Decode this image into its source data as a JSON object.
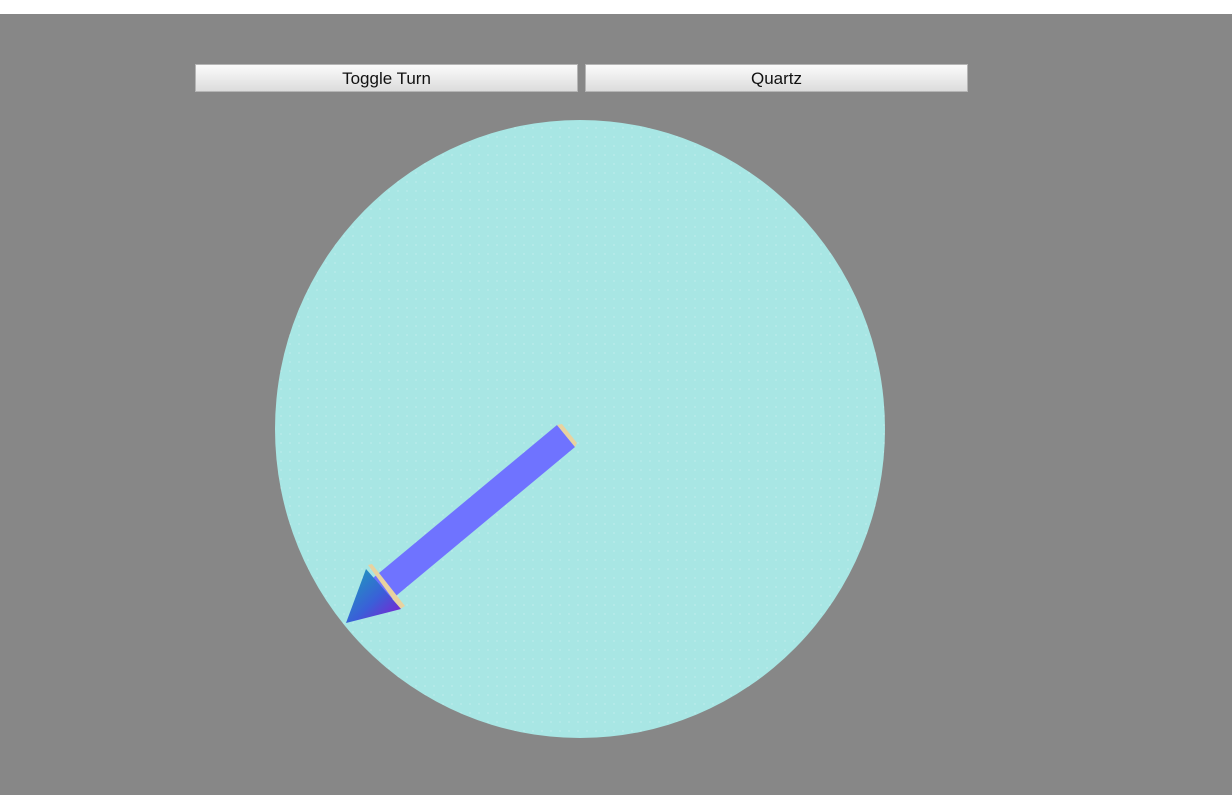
{
  "toolbar": {
    "toggle_label": "Toggle Turn",
    "quartz_label": "Quartz"
  },
  "scene": {
    "dial_color": "#a8e6e4",
    "background_color": "#878787",
    "arrow_shaft_color": "#6f73ff",
    "arrow_rim_color": "#e8d2a0",
    "arrow_head_gradient": [
      "#1aa3b8",
      "#3a5fd8",
      "#8a18d0"
    ]
  }
}
